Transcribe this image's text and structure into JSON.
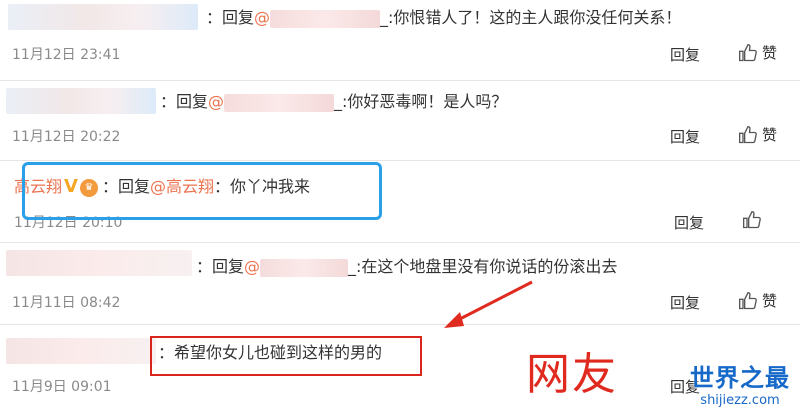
{
  "comments": [
    {
      "text": "你恨错人了！这的主人跟你没任何关系！",
      "time": "11月12日 23:41"
    },
    {
      "text": "你好恶毒啊！是人吗？",
      "time": "11月12日 20:22"
    },
    {
      "author": "高云翔",
      "mention": "@高云翔",
      "text": "你丫冲我来",
      "time": "11月12日 20:10"
    },
    {
      "text": "在这个地盘里没有你说话的份滚出去",
      "time": "11月11日 08:42"
    },
    {
      "text": "希望你女儿也碰到这样的男的",
      "time": "11月9日 09:01"
    }
  ],
  "labels": {
    "reply_prefix": "：回复",
    "reply_prefix_short": "：回复",
    "reply_action": "回复",
    "like": "赞",
    "colon": "：",
    "underscore_colon": "_:"
  },
  "annotation": {
    "text": "网友",
    "color": "#e02a1f"
  },
  "watermark": {
    "title": "世界之最",
    "url": "shijiezz.com"
  },
  "colors": {
    "mention": "#eb7350",
    "blue_box": "#2aa0e8",
    "red_box": "#d9241c"
  }
}
